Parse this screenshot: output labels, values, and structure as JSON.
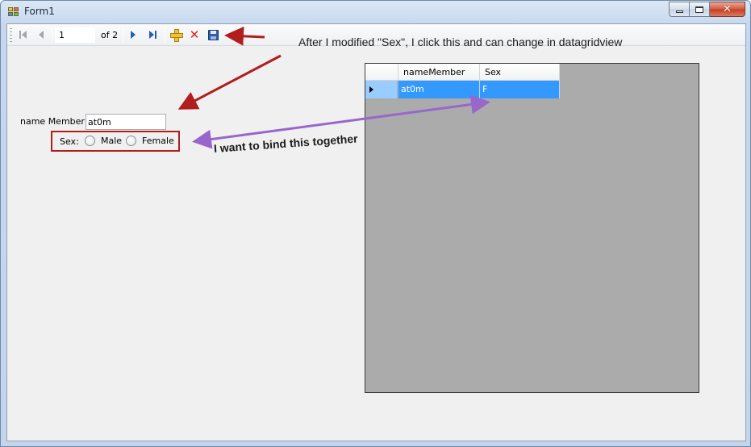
{
  "window": {
    "title": "Form1",
    "caption_buttons": [
      "minimize",
      "maximize",
      "close"
    ]
  },
  "navigator": {
    "position": "1",
    "count_label": "of 2",
    "icons": [
      "move-first-icon",
      "move-previous-icon",
      "move-next-icon",
      "move-last-icon",
      "add-new-icon",
      "delete-icon",
      "save-icon"
    ]
  },
  "form": {
    "name_label": "name Member:",
    "name_value": "at0m",
    "sex_label": "Sex:",
    "male_label": "Male",
    "female_label": "Female"
  },
  "grid": {
    "columns": [
      "nameMember",
      "Sex"
    ],
    "rows": [
      {
        "nameMember": "at0m",
        "Sex": "F"
      }
    ],
    "selection_color": "#3399ff"
  },
  "annotations": {
    "top_note": "After I modified \"Sex\", I click this and can change in datagridview",
    "bind_note": "I want to bind this together",
    "arrow_red": "#b01e1e",
    "arrow_purple": "#9966cc"
  }
}
